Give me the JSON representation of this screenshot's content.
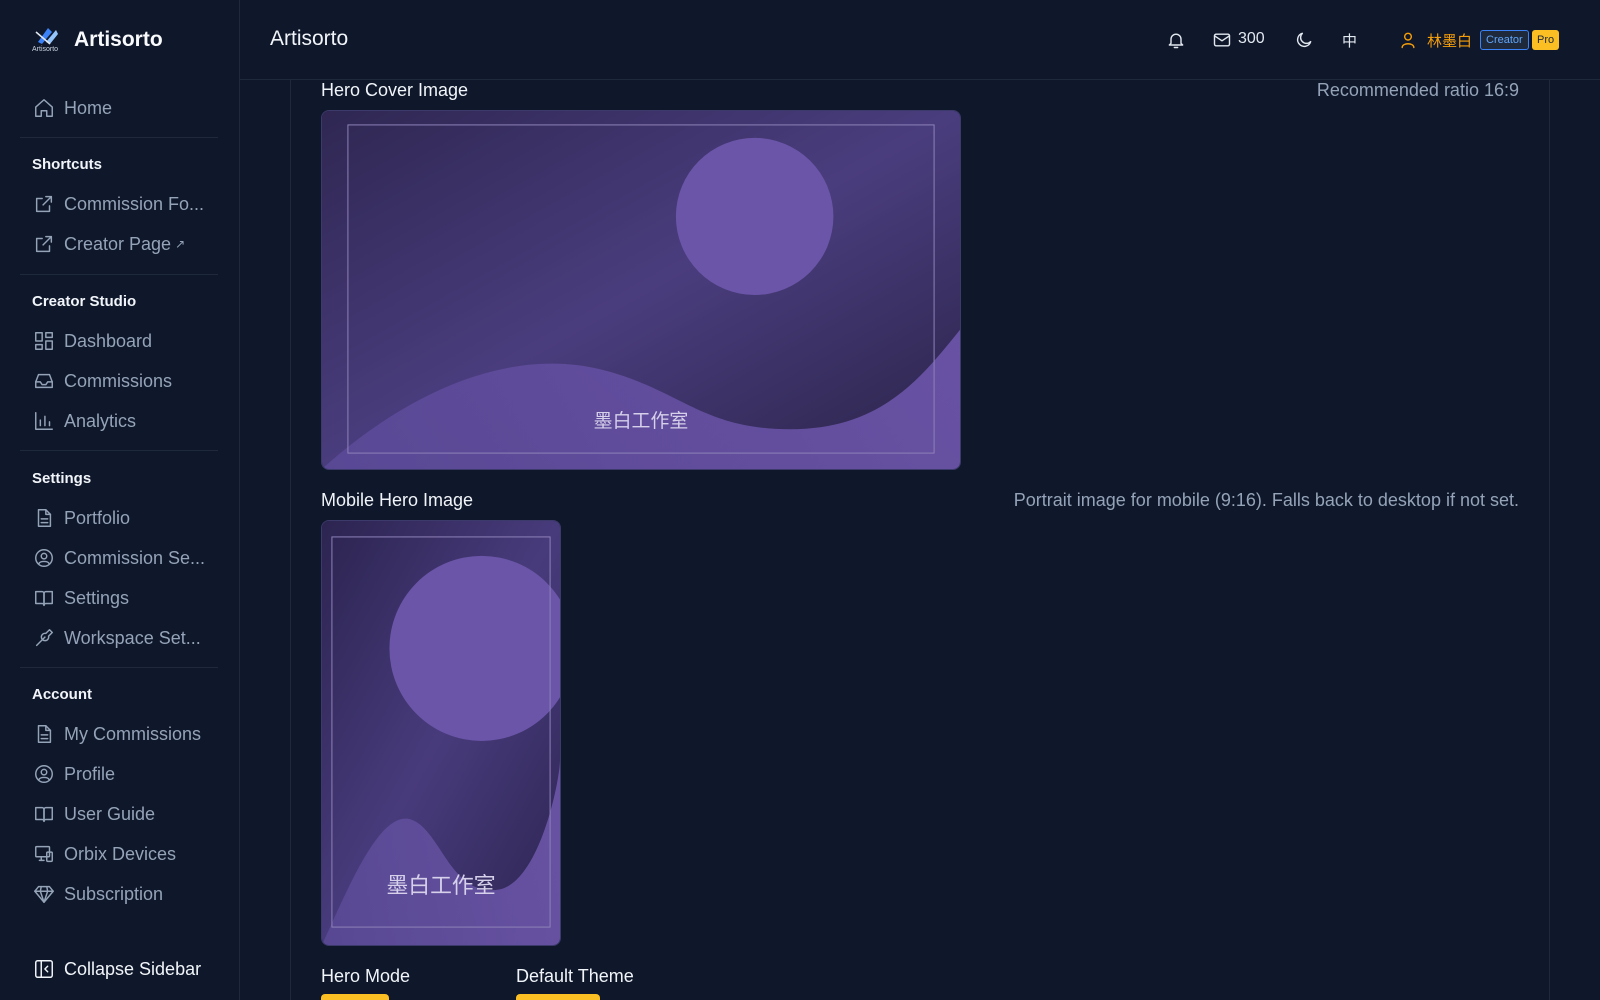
{
  "brand": {
    "name": "Artisorto",
    "logo_text": "Artisorto"
  },
  "sidebar": {
    "home": "Home",
    "shortcuts_title": "Shortcuts",
    "shortcuts": [
      "Commission Fo...",
      "Creator Page"
    ],
    "creator_studio_title": "Creator Studio",
    "creator_studio": [
      "Dashboard",
      "Commissions",
      "Analytics"
    ],
    "settings_title": "Settings",
    "settings": [
      "Portfolio",
      "Commission Se...",
      "Settings",
      "Workspace Set..."
    ],
    "account_title": "Account",
    "account": [
      "My Commissions",
      "Profile",
      "User Guide",
      "Orbix Devices",
      "Subscription"
    ],
    "collapse": "Collapse Sidebar"
  },
  "header": {
    "title": "Artisorto",
    "mail_count": "300",
    "lang": "中",
    "user_name": "林墨白",
    "badge_creator": "Creator",
    "badge_pro": "Pro"
  },
  "main": {
    "hero_cover_label": "Hero Cover Image",
    "hero_cover_hint": "Recommended ratio 16:9",
    "hero_cover_caption": "墨白工作室",
    "mobile_hero_label": "Mobile Hero Image",
    "mobile_hero_hint": "Portrait image for mobile (9:16). Falls back to desktop if not set.",
    "mobile_hero_caption": "墨白工作室",
    "hero_mode_label": "Hero Mode",
    "default_theme_label": "Default Theme"
  },
  "colors": {
    "accent": "#fbbf24",
    "background": "#0f172a",
    "user": "#f59e0b",
    "image_purple": "#6b55a8"
  }
}
